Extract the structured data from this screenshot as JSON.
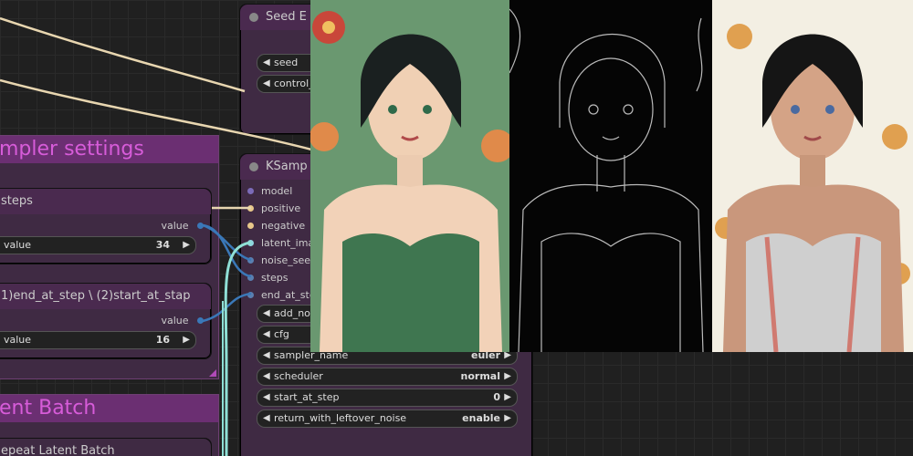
{
  "groups": {
    "sampler_settings": {
      "title": "mpler settings"
    },
    "latent_batch": {
      "title": "ent Batch"
    }
  },
  "nodes": {
    "steps": {
      "title": "steps",
      "output_label": "value",
      "widget_label": "value",
      "widget_value": "34"
    },
    "end_at_step": {
      "title": "1)end_at_step \\ (2)start_at_stap",
      "output_label": "value",
      "widget_label": "value",
      "widget_value": "16"
    },
    "repeat_latent": {
      "title": "epeat Latent Batch"
    },
    "seed": {
      "title": "Seed E",
      "widgets": [
        {
          "label": "seed"
        },
        {
          "label": "control_"
        }
      ]
    },
    "ksampler": {
      "title": "KSamp",
      "inputs": [
        {
          "label": "model",
          "color": "#7b6bb8"
        },
        {
          "label": "positive",
          "color": "#e8c88a"
        },
        {
          "label": "negative",
          "color": "#e8c88a"
        },
        {
          "label": "latent_imag",
          "color": "#8fd6e0"
        },
        {
          "label": "noise_seed",
          "color": "#5a7fb0"
        },
        {
          "label": "steps",
          "color": "#5a7fb0"
        },
        {
          "label": "end_at_ste",
          "color": "#5a7fb0"
        }
      ],
      "widgets": [
        {
          "label": "add_noi",
          "value": ""
        },
        {
          "label": "cfg",
          "value": ""
        },
        {
          "label": "sampler_name",
          "value": "euler"
        },
        {
          "label": "scheduler",
          "value": "normal"
        },
        {
          "label": "start_at_step",
          "value": "0"
        },
        {
          "label": "return_with_leftover_noise",
          "value": "enable"
        }
      ]
    }
  },
  "images": {
    "image_1": {
      "icon": "portrait-illustration-green-dress"
    },
    "image_2": {
      "icon": "portrait-lineart-black"
    },
    "image_3": {
      "icon": "portrait-illustration-white-dress"
    }
  },
  "colors": {
    "link_cream": "#e8d6b0",
    "link_blue": "#3a78b8",
    "link_cyan": "#8fe0d6",
    "group_header": "#6b2f72",
    "group_title_text": "#d75cd9"
  }
}
